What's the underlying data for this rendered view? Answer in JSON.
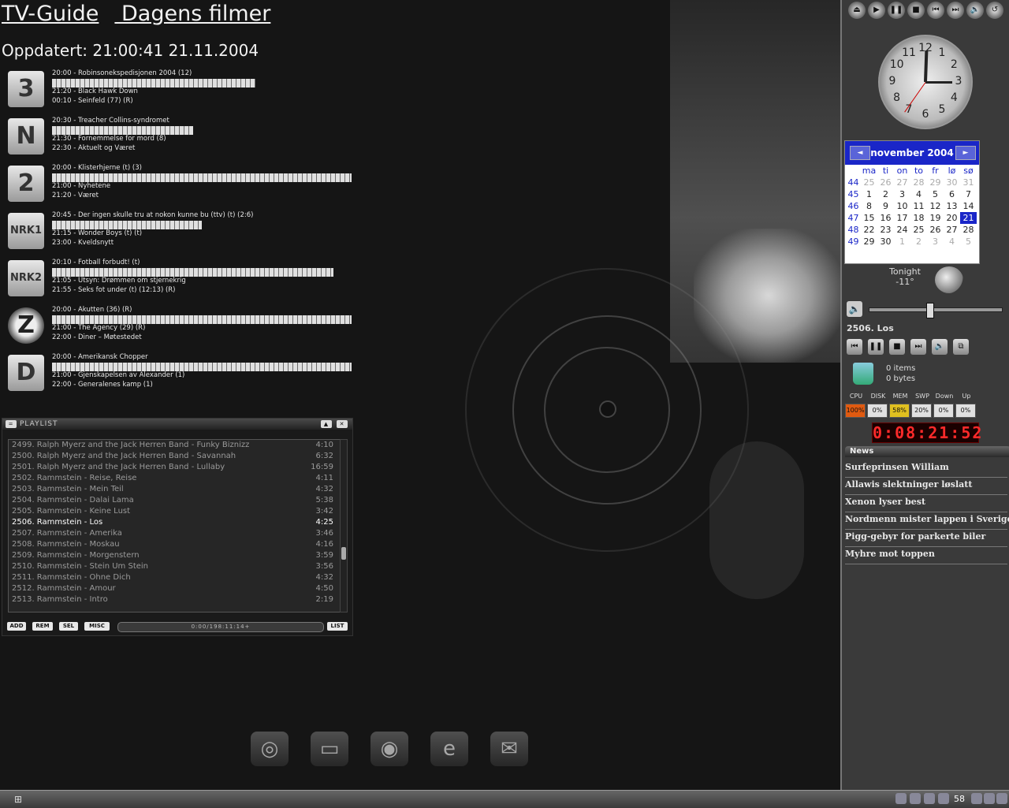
{
  "tv": {
    "title": "TV-Guide",
    "subtitle": "Dagens filmer",
    "updated": "Oppdatert: 21:00:41 21.11.2004",
    "channels": [
      {
        "logo": "3",
        "round": false,
        "lines": [
          "20:00 - Robinsonekspedisjonen 2004 (12)",
          "21:20 - Black Hawk Down",
          "00:10 - Seinfeld (77) (R)"
        ],
        "progress": 0.68
      },
      {
        "logo": "N",
        "round": false,
        "lines": [
          "20:30 - Treacher Collins-syndromet",
          "21:30 - Fornemmelse for mord (8)",
          "22:30 - Aktuelt og Været"
        ],
        "progress": 0.47
      },
      {
        "logo": "2",
        "round": false,
        "lines": [
          "20:00 - Klisterhjerne (t) (3)",
          "21:00 - Nyhetene",
          "21:20 - Været"
        ],
        "progress": 1.0
      },
      {
        "logo": "NRK1",
        "round": false,
        "lines": [
          "20:45 - Der ingen skulle tru at nokon kunne bu (ttv) (t) (2:6)",
          "21:15 - Wonder Boys (t) (t)",
          "23:00 - Kveldsnytt"
        ],
        "progress": 0.5
      },
      {
        "logo": "NRK2",
        "round": false,
        "lines": [
          "20:10 - Fotball forbudt! (t)",
          "21:05 - Utsyn: Drømmen om stjernekrig",
          "21:55 - Seks fot under (t) (12:13) (R)"
        ],
        "progress": 0.94
      },
      {
        "logo": "Z",
        "round": true,
        "lines": [
          "20:00 - Akutten (36) (R)",
          "21:00 - The Agency (29) (R)",
          "22:00 - Diner – Møtestedet"
        ],
        "progress": 1.0
      },
      {
        "logo": "D",
        "round": false,
        "lines": [
          "20:00 - Amerikansk Chopper",
          "21:00 - Gjenskapelsen av Alexander (1)",
          "22:00 - Generalenes kamp (1)"
        ],
        "progress": 1.0
      }
    ]
  },
  "playlist": {
    "title": "PLAYLIST",
    "btn_up": "▲",
    "btn_close": "✕",
    "btn_menu": "=",
    "rows": [
      {
        "title": "2499. Ralph Myerz and the Jack Herren Band - Funky Biznizz",
        "dur": "4:10"
      },
      {
        "title": "2500. Ralph Myerz and the Jack Herren Band - Savannah",
        "dur": "6:32"
      },
      {
        "title": "2501. Ralph Myerz and the Jack Herren Band - Lullaby",
        "dur": "16:59"
      },
      {
        "title": "2502. Rammstein - Reise, Reise",
        "dur": "4:11"
      },
      {
        "title": "2503. Rammstein - Mein Teil",
        "dur": "4:32"
      },
      {
        "title": "2504. Rammstein - Dalai Lama",
        "dur": "5:38"
      },
      {
        "title": "2505. Rammstein - Keine Lust",
        "dur": "3:42"
      },
      {
        "title": "2506. Rammstein - Los",
        "dur": "4:25",
        "current": true
      },
      {
        "title": "2507. Rammstein - Amerika",
        "dur": "3:46"
      },
      {
        "title": "2508. Rammstein - Moskau",
        "dur": "4:16"
      },
      {
        "title": "2509. Rammstein - Morgenstern",
        "dur": "3:59"
      },
      {
        "title": "2510. Rammstein - Stein Um Stein",
        "dur": "3:56"
      },
      {
        "title": "2511. Rammstein - Ohne Dich",
        "dur": "4:32"
      },
      {
        "title": "2512. Rammstein - Amour",
        "dur": "4:50"
      },
      {
        "title": "2513. Rammstein - Intro",
        "dur": "2:19"
      }
    ],
    "buttons": {
      "add": "ADD",
      "rem": "REM",
      "sel": "SEL",
      "misc": "MISC",
      "list": "LIST"
    },
    "time": "0:00/198:11:14+"
  },
  "sidebar": {
    "media_top": [
      "⏏",
      "▶",
      "❚❚",
      "■",
      "⏮",
      "⏭",
      "🔈",
      "↺"
    ],
    "clock_numbers": [
      "12",
      "1",
      "2",
      "3",
      "4",
      "5",
      "6",
      "7",
      "8",
      "9",
      "10",
      "11"
    ],
    "calendar": {
      "month": "november 2004",
      "prev": "◄",
      "next": "►",
      "dow": [
        "ma",
        "ti",
        "on",
        "to",
        "fr",
        "lø",
        "sø"
      ],
      "weeks": [
        {
          "wk": "44",
          "days": [
            "25",
            "26",
            "27",
            "28",
            "29",
            "30",
            "31"
          ],
          "muted": [
            0,
            1,
            2,
            3,
            4,
            5,
            6
          ]
        },
        {
          "wk": "45",
          "days": [
            "1",
            "2",
            "3",
            "4",
            "5",
            "6",
            "7"
          ],
          "muted": []
        },
        {
          "wk": "46",
          "days": [
            "8",
            "9",
            "10",
            "11",
            "12",
            "13",
            "14"
          ],
          "muted": []
        },
        {
          "wk": "47",
          "days": [
            "15",
            "16",
            "17",
            "18",
            "19",
            "20",
            "21"
          ],
          "muted": [],
          "today": 6
        },
        {
          "wk": "48",
          "days": [
            "22",
            "23",
            "24",
            "25",
            "26",
            "27",
            "28"
          ],
          "muted": []
        },
        {
          "wk": "49",
          "days": [
            "29",
            "30",
            "1",
            "2",
            "3",
            "4",
            "5"
          ],
          "muted": [
            2,
            3,
            4,
            5,
            6
          ]
        }
      ]
    },
    "weather": {
      "label": "Tonight",
      "temp": "-11°"
    },
    "volume": {
      "icon": "🔈",
      "level": 0.45
    },
    "now_playing": "2506. Los",
    "media_bot": [
      "⏮",
      "❚❚",
      "■",
      "⏭",
      "🔈",
      "⧉"
    ],
    "recycle": {
      "items": "0 items",
      "bytes": "0 bytes"
    },
    "sys": [
      {
        "label": "CPU",
        "value": "100%",
        "state": "hot"
      },
      {
        "label": "DISK",
        "value": "0%",
        "state": ""
      },
      {
        "label": "MEM",
        "value": "58%",
        "state": "warn"
      },
      {
        "label": "SWP",
        "value": "20%",
        "state": ""
      },
      {
        "label": "Down",
        "value": "0%",
        "state": ""
      },
      {
        "label": "Up",
        "value": "0%",
        "state": ""
      }
    ],
    "led_time": "0:08:21:52",
    "news_title": "News",
    "news": [
      "Surfeprinsen William",
      "Allawis slektninger løslatt",
      "Xenon lyser best",
      "Nordmenn mister lappen i Sverige",
      "Pigg-gebyr for parkerte biler",
      "Myhre mot toppen"
    ]
  },
  "taskbar": {
    "start": "⊞",
    "tray_num": "58"
  }
}
